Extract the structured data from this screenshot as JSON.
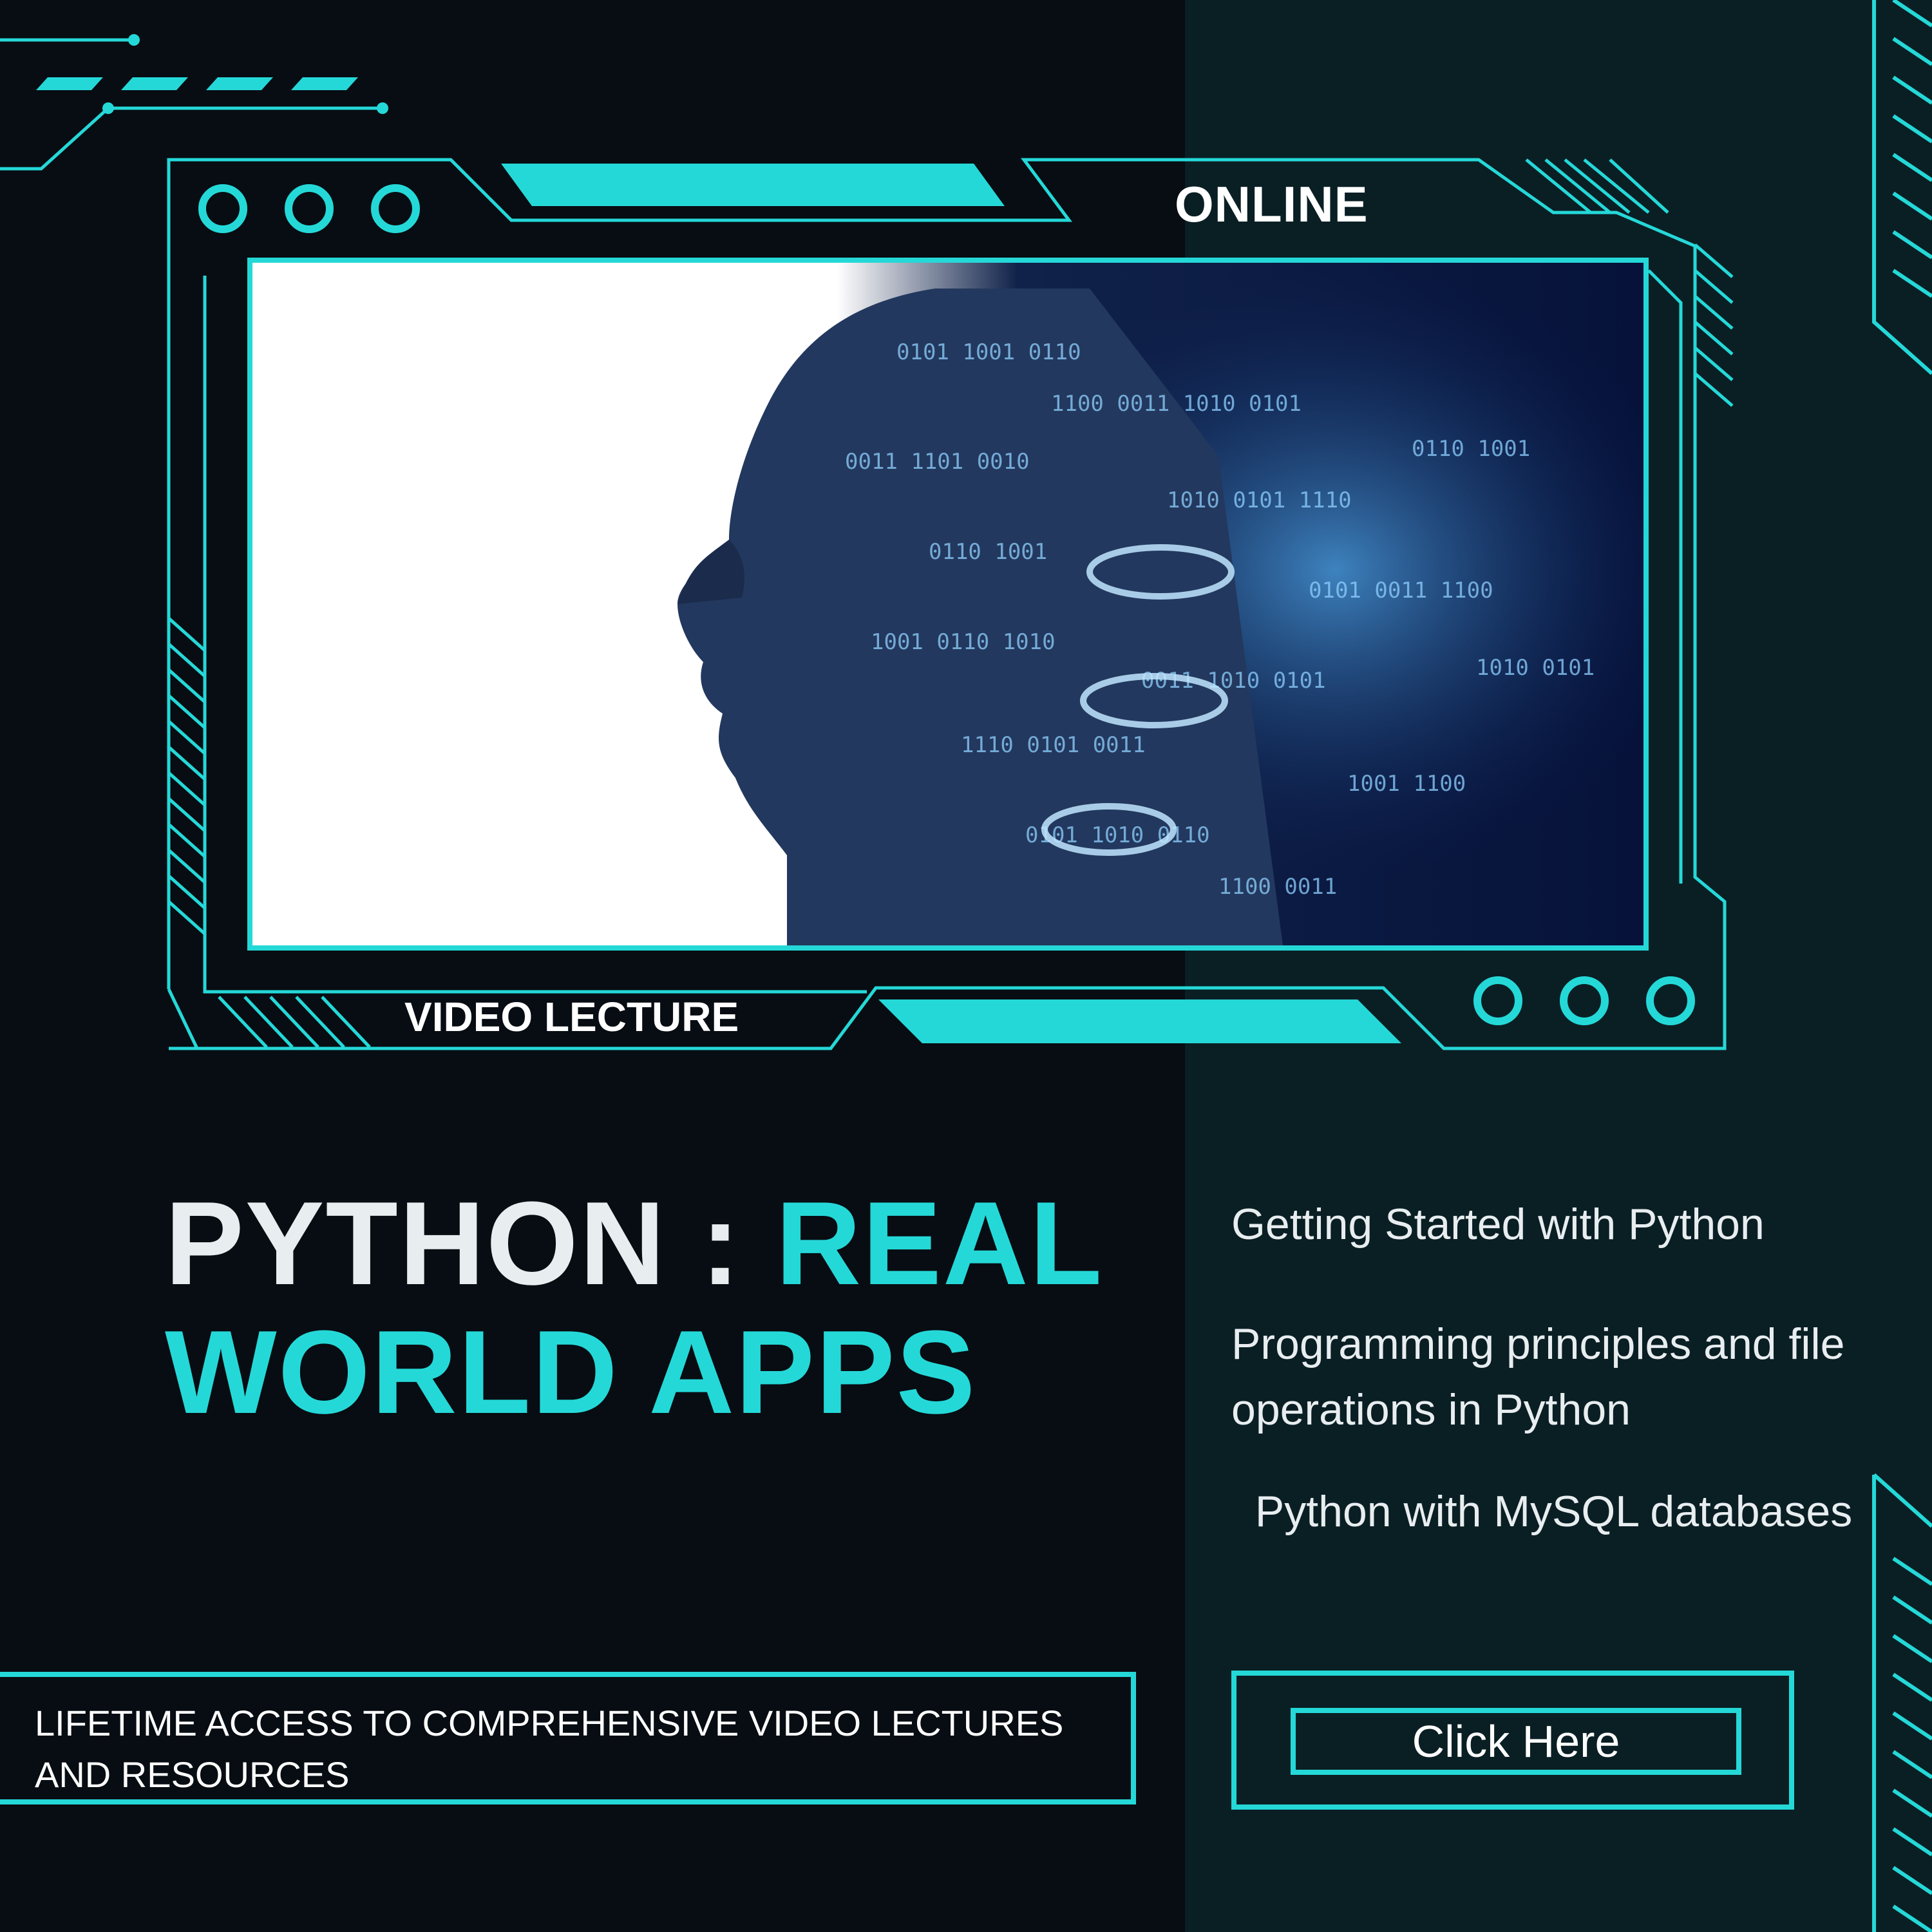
{
  "badges": {
    "top": "ONLINE",
    "bottom": "VIDEO LECTURE"
  },
  "title": {
    "part1": "PYTHON : ",
    "part2": "REAL",
    "part3": "WORLD APPS"
  },
  "topics": [
    "Getting Started with Python",
    "Programming principles and file operations in Python",
    " Python with MySQL databases"
  ],
  "access_text": "LIFETIME ACCESS TO COMPREHENSIVE VIDEO LECTURES AND RESOURCES",
  "cta_label": "Click Here",
  "colors": {
    "background": "#070d12",
    "panel": "#0a1f24",
    "accent": "#25d8d8",
    "text": "#e8edf0"
  },
  "image": {
    "subject": "woman profile with digital binary code overlay"
  }
}
